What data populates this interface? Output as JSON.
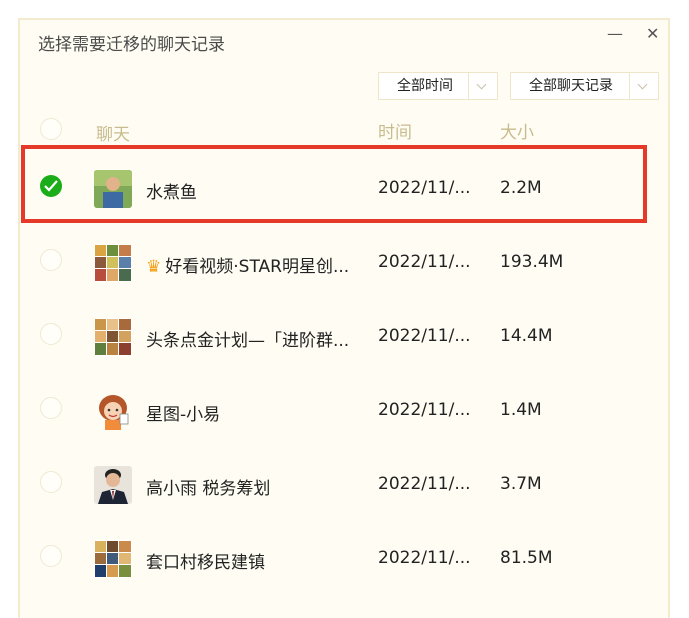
{
  "dialog": {
    "title": "选择需要迁移的聊天记录",
    "minimize_glyph": "—",
    "close_glyph": "✕"
  },
  "filters": {
    "time_label": "全部时间",
    "records_label": "全部聊天记录"
  },
  "columns": {
    "chat": "聊天",
    "time": "时间",
    "size": "大小"
  },
  "rows": [
    {
      "name": "水煮鱼",
      "time": "2022/11/...",
      "size": "2.2M",
      "checked": true,
      "avatar": "photo-man-outdoor"
    },
    {
      "name": "好看视频·STAR明星创...",
      "time": "2022/11/...",
      "size": "193.4M",
      "checked": false,
      "avatar": "group-grid",
      "icon": "crown-icon"
    },
    {
      "name": "头条点金计划—「进阶群...",
      "time": "2022/11/...",
      "size": "14.4M",
      "checked": false,
      "avatar": "group-grid"
    },
    {
      "name": "星图-小易",
      "time": "2022/11/...",
      "size": "1.4M",
      "checked": false,
      "avatar": "cartoon-girl"
    },
    {
      "name": "高小雨 税务筹划",
      "time": "2022/11/...",
      "size": "3.7M",
      "checked": false,
      "avatar": "photo-man-suit"
    },
    {
      "name": "套口村移民建镇",
      "time": "2022/11/...",
      "size": "81.5M",
      "checked": false,
      "avatar": "group-grid"
    }
  ],
  "colors": {
    "accent_green": "#1aad19",
    "highlight_red": "#e53a2a",
    "header_text": "#c8bb8e",
    "dialog_bg": "#fffdf3"
  }
}
